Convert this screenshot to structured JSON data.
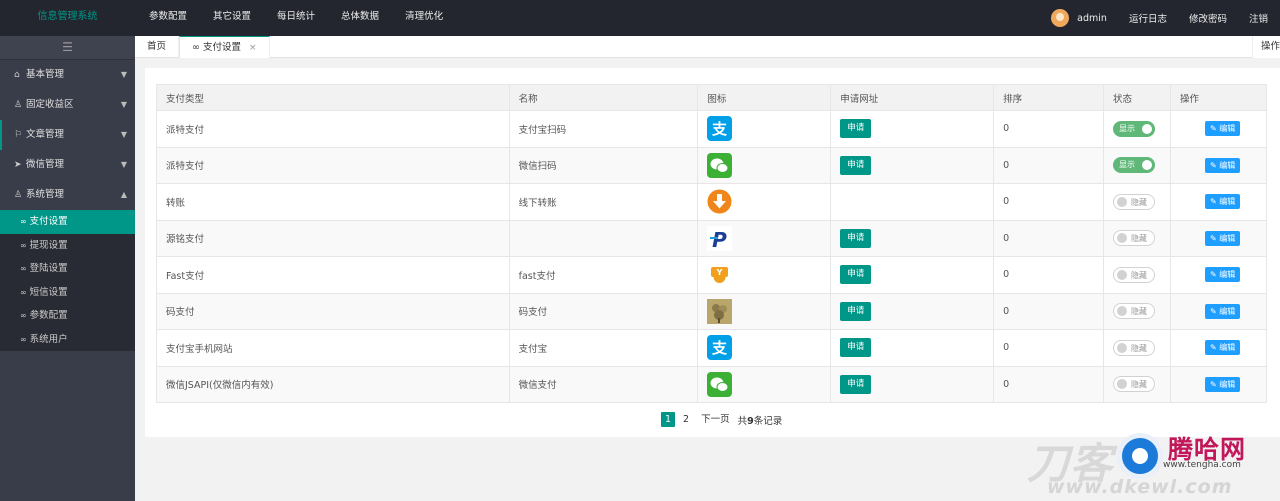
{
  "app": {
    "title": "信息管理系统"
  },
  "topnav": [
    "参数配置",
    "其它设置",
    "每日统计",
    "总体数据",
    "清理优化"
  ],
  "user": {
    "name": "admin",
    "log": "运行日志",
    "password": "修改密码",
    "logout": "注销"
  },
  "sidebar": {
    "toggle": "☰",
    "menus": [
      {
        "label": "基本管理",
        "icon": "home-icon"
      },
      {
        "label": "固定收益区",
        "icon": "user-icon"
      },
      {
        "label": "文章管理",
        "icon": "flag-icon"
      },
      {
        "label": "微信管理",
        "icon": "send-icon"
      },
      {
        "label": "系统管理",
        "icon": "user-icon"
      }
    ],
    "submenu": [
      "支付设置",
      "提现设置",
      "登陆设置",
      "短信设置",
      "参数配置",
      "系统用户"
    ]
  },
  "tabs": {
    "home": "首页",
    "current": "支付设置",
    "close": "×",
    "operations": "操作"
  },
  "table": {
    "headers": [
      "支付类型",
      "名称",
      "图标",
      "申请网址",
      "排序",
      "状态",
      "操作"
    ],
    "apply_label": "申请",
    "edit_label": "编辑",
    "show_label": "显示",
    "hide_label": "隐藏",
    "rows": [
      {
        "type": "派特支付",
        "name": "支付宝扫码",
        "icon": "alipay-icon",
        "apply": true,
        "sort": "0",
        "status": "on"
      },
      {
        "type": "派特支付",
        "name": "微信扫码",
        "icon": "wechat-icon",
        "apply": true,
        "sort": "0",
        "status": "on"
      },
      {
        "type": "转账",
        "name": "线下转账",
        "icon": "download-icon",
        "apply": false,
        "sort": "0",
        "status": "off"
      },
      {
        "type": "源铭支付",
        "name": "",
        "icon": "paypal-icon",
        "apply": true,
        "sort": "0",
        "status": "off"
      },
      {
        "type": "Fast支付",
        "name": "fast支付",
        "icon": "fast-pay-icon",
        "apply": true,
        "sort": "0",
        "status": "off"
      },
      {
        "type": "码支付",
        "name": "码支付",
        "icon": "code-pay-icon",
        "apply": true,
        "sort": "0",
        "status": "off"
      },
      {
        "type": "支付宝手机网站",
        "name": "支付宝",
        "icon": "alipay-icon",
        "apply": true,
        "sort": "0",
        "status": "off"
      },
      {
        "type": "微信JSAPI(仅微信内有效)",
        "name": "微信支付",
        "icon": "wechat-icon",
        "apply": true,
        "sort": "0",
        "status": "off"
      }
    ]
  },
  "pagination": {
    "pages": [
      "1",
      "2"
    ],
    "next": "下一页",
    "total_prefix": "共",
    "total_count": "9",
    "total_suffix": "条记录"
  },
  "watermark": {
    "left": "刀客",
    "name": "腾哈网",
    "url": "www.tengha.com",
    "url2": "www.dkewl.com"
  },
  "colors": {
    "accent": "#009688",
    "topbar": "#23262e",
    "sidebar": "#393d49",
    "edit": "#1e9fff",
    "switch_on": "#5fb878"
  }
}
